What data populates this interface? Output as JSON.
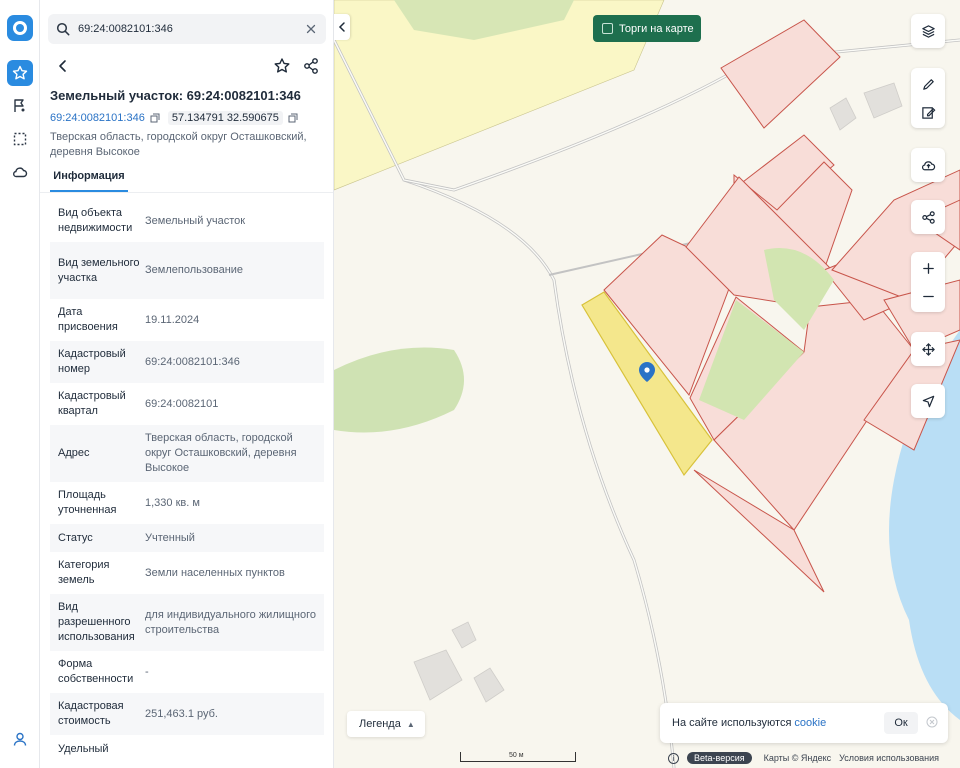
{
  "search": {
    "value": "69:24:0082101:346"
  },
  "object": {
    "title": "Земельный участок: 69:24:0082101:346",
    "cadastral_link": "69:24:0082101:346",
    "coords": "57.134791 32.590675",
    "address": "Тверская область, городской округ Осташковский, деревня Высокое"
  },
  "tabs": [
    {
      "label": "Информация",
      "active": true
    }
  ],
  "properties": [
    {
      "key": "Вид объекта недвижимости",
      "value": "Земельный участок"
    },
    {
      "key": "Вид земельного участка",
      "value": "Землепользование"
    },
    {
      "key": "Дата присвоения",
      "value": "19.11.2024"
    },
    {
      "key": "Кадастровый номер",
      "value": "69:24:0082101:346"
    },
    {
      "key": "Кадастровый квартал",
      "value": "69:24:0082101"
    },
    {
      "key": "Адрес",
      "value": "Тверская область, городской округ Осташковский, деревня Высокое"
    },
    {
      "key": "Площадь уточненная",
      "value": "1,330 кв. м"
    },
    {
      "key": "Статус",
      "value": "Учтенный"
    },
    {
      "key": "Категория земель",
      "value": "Земли населенных пунктов"
    },
    {
      "key": "Вид разрешенного использования",
      "value": "для индивидуального жилищного строительства"
    },
    {
      "key": "Форма собственности",
      "value": "-"
    },
    {
      "key": "Кадастровая стоимость",
      "value": "251,463.1 руб."
    },
    {
      "key": "Удельный",
      "value": ""
    }
  ],
  "map": {
    "torgi_label": "Торги на карте",
    "legend_label": "Легенда",
    "scale_label": "50 м",
    "beta_label": "Beta-версия",
    "maps_label": "Карты © Яндекс",
    "terms_label": "Условия использования"
  },
  "cookie": {
    "text": "На сайте используются",
    "link": "cookie",
    "ok": "Ок"
  },
  "colors": {
    "accent": "#2a8be0",
    "parcel_fill": "#f8ddd8",
    "parcel_stroke": "#c8554b",
    "selected_fill": "#f3e47a",
    "forest": "#cfe2b3",
    "water": "#b9def5",
    "torgi": "#1e6f4e"
  }
}
